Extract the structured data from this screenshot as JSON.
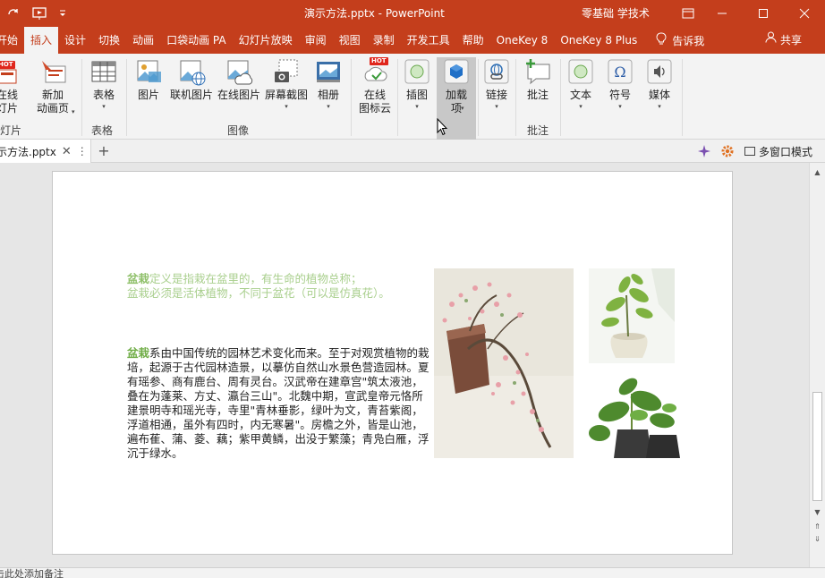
{
  "window": {
    "title": "演示方法.pptx  -  PowerPoint",
    "user": "零基础 学技术",
    "accent": "#c43e1c"
  },
  "qat": {
    "icons": [
      "redo-icon",
      "slideshow-from-start-icon",
      "customize-qat-icon"
    ]
  },
  "tabs": [
    "开始",
    "插入",
    "设计",
    "切换",
    "动画",
    "口袋动画 PA",
    "幻灯片放映",
    "审阅",
    "视图",
    "录制",
    "开发工具",
    "帮助",
    "OneKey 8",
    "OneKey 8 Plus"
  ],
  "tell_me": "告诉我",
  "share": "共享",
  "ribbon": {
    "buttons": {
      "online_slides": "在线\n灯片",
      "new_anim_page": "新加\n动画页",
      "table": "表格",
      "picture": "图片",
      "online_picture": "联机图片",
      "online_pic2": "在线图片",
      "screenshot": "屏幕截图",
      "album": "相册",
      "icon_cloud": "在线\n图标云",
      "illustrations": "插图",
      "addins": "加载\n项",
      "links": "链接",
      "comment": "批注",
      "text": "文本",
      "symbols": "符号",
      "media": "媒体"
    },
    "groups": {
      "slides": "灯片",
      "tables": "表格",
      "images": "图像",
      "comments": "批注"
    },
    "hot": "HOT"
  },
  "doctab": {
    "name": "示方法.pptx",
    "multiwindow": "多窗口模式"
  },
  "slide": {
    "p1_kw": "盆栽",
    "p1_line1": "定义是指栽在盆里的，有生命的植物总称；",
    "p1_line2": "盆栽必须是活体植物，不同于盆花（可以是仿真花）。",
    "p2_kw": "盆栽",
    "p2_text": "系由中国传统的园林艺术变化而来。至于对观赏植物的栽培，起源于古代园林造景，以摹仿自然山水景色营造园林。夏有瑶参、商有鹿台、周有灵台。汉武帝在建章宫\"筑太液池，叠在为蓬莱、方丈、瀛台三山\"。北魏中期，宣武皇帝元恪所建景明寺和瑶光寺，寺里\"青林垂影，绿叶为文，青苔紫阁，浮道相通，虽外有四时，内无寒暑\"。房檐之外，皆是山池，遍布萑、蒲、菱、藕；紫甲黄鳞，出没于繁藻；青凫白雁，浮沉于绿水。",
    "text_accent": "#70ad47",
    "text_faded": "#a9cf8d"
  },
  "status": {
    "notes_hint": "击此处添加备注"
  }
}
